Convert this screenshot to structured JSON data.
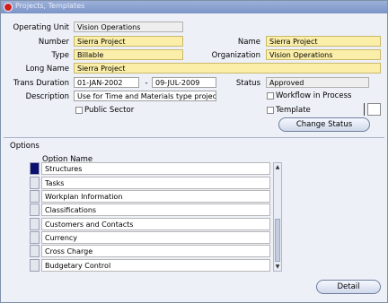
{
  "window": {
    "title": "Projects, Templates"
  },
  "header": {
    "operating_unit_label": "Operating Unit",
    "operating_unit_value": "Vision Operations",
    "number_label": "Number",
    "number_value": "Sierra Project",
    "name_label": "Name",
    "name_value": "Sierra Project",
    "type_label": "Type",
    "type_value": "Billable",
    "organization_label": "Organization",
    "organization_value": "Vision Operations",
    "long_name_label": "Long Name",
    "long_name_value": "Sierra Project",
    "trans_duration_label": "Trans Duration",
    "trans_start": "01-JAN-2002",
    "trans_sep": "-",
    "trans_end": "09-JUL-2009",
    "status_label": "Status",
    "status_value": "Approved",
    "description_label": "Description",
    "description_value": "Use for Time and Materials type projects",
    "workflow_label": "Workflow in Process",
    "public_sector_label": "Public Sector",
    "template_label": "Template",
    "change_status_button": "Change Status"
  },
  "options": {
    "section_label": "Options",
    "column_header": "Option Name",
    "rows": [
      "Structures",
      "Tasks",
      "Workplan Information",
      "Classifications",
      "Customers and Contacts",
      "Currency",
      "Cross Charge",
      "Budgetary Control"
    ]
  },
  "footer": {
    "detail_button": "Detail"
  }
}
